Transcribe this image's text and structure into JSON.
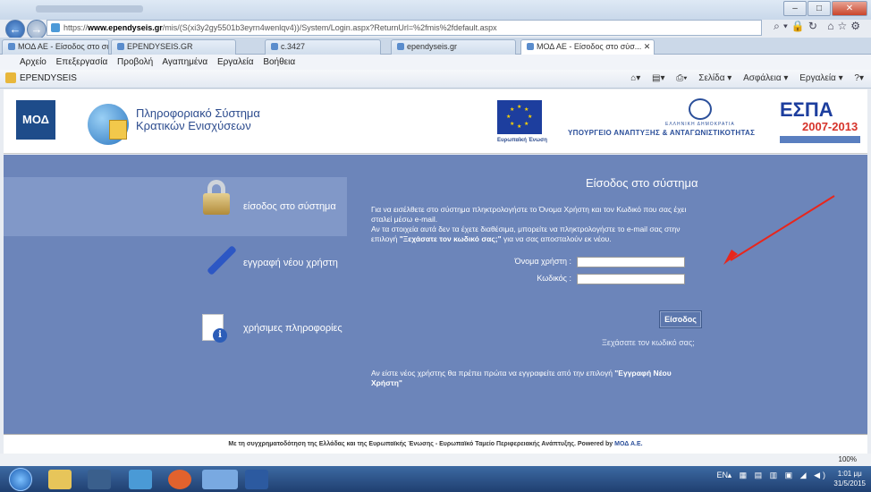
{
  "browser": {
    "url_prefix": "https://",
    "url_host": "www.ependyseis.gr",
    "url_path": "/mis/(S(xi3y2gy5501b3eyrn4wenlqv4))/System/Login.aspx?ReturnUrl=%2fmis%2fdefault.aspx",
    "tabs": [
      {
        "label": "ΜΟΔ ΑΕ - Είσοδος στο σύστημα"
      },
      {
        "label": "EPENDYSEIS.GR"
      },
      {
        "label": "c.3427"
      },
      {
        "label": "ependyseis.gr"
      },
      {
        "label": "ΜΟΔ ΑΕ - Είσοδος στο σύσ... ✕"
      }
    ],
    "menu": [
      "Αρχείο",
      "Επεξεργασία",
      "Προβολή",
      "Αγαπημένα",
      "Εργαλεία",
      "Βοήθεια"
    ],
    "favorite": "EPENDYSEIS",
    "commands": [
      "Σελίδα ▾",
      "Ασφάλεια ▾",
      "Εργαλεία ▾"
    ],
    "zoom": "100%"
  },
  "header": {
    "moa_logo": "ΜΟΔ",
    "system_title_line1": "Πληροφοριακό Σύστημα",
    "system_title_line2": "Κρατικών Ενισχύσεων",
    "eu_caption": "Ευρωπαϊκή Ένωση",
    "ministry_sub": "ΕΛΛΗΝΙΚΗ ΔΗΜΟΚΡΑΤΙΑ",
    "ministry": "ΥΠΟΥΡΓΕΙΟ ΑΝΑΠΤΥΞΗΣ & ΑΝΤΑΓΩΝΙΣΤΙΚΟΤΗΤΑΣ",
    "espa": "ΕΣΠΑ",
    "espa_years": "2007-2013"
  },
  "sidebar": {
    "items": [
      {
        "label": "είσοδος στο σύστημα",
        "icon": "padlock-icon"
      },
      {
        "label": "εγγραφή νέου χρήστη",
        "icon": "pen-icon"
      },
      {
        "label": "χρήσιμες πληροφορίες",
        "icon": "info-document-icon"
      }
    ]
  },
  "login": {
    "title": "Είσοδος στο σύστημα",
    "intro_line1": "Για να εισέλθετε στο σύστημα πληκτρολογήστε το Όνομα Χρήστη και τον Κωδικό που σας έχει σταλεί μέσω e-mail.",
    "intro_line2_a": "Αν τα στοιχεία αυτά δεν τα έχετε διαθέσιμα, μπορείτε να πληκτρολογήστε το e-mail σας στην επιλογή ",
    "intro_line2_b": "\"Ξεχάσατε τον κωδικό σας;\"",
    "intro_line2_c": " για να σας αποσταλούν εκ νέου.",
    "username_label": "Όνομα χρήστη :",
    "username_value": "",
    "password_label": "Κωδικός :",
    "password_value": "",
    "button": "Είσοδος",
    "forgot": "Ξεχάσατε τον κωδικό σας;",
    "newuser_a": "Αν είστε νέος χρήστης θα πρέπει πρώτα να εγγραφείτε από την επιλογή ",
    "newuser_b": "\"Εγγραφή Νέου Χρήστη\""
  },
  "footer": {
    "text": "Με τη συγχρηματοδότηση της Ελλάδας και της Ευρωπαϊκής Ένωσης - Ευρωπαϊκό Ταμείο Περιφερειακής Ανάπτυξης.",
    "powered": "Powered by",
    "company": "ΜΟΔ Α.Ε."
  },
  "taskbar": {
    "lang": "EN",
    "time": "1:01 μμ",
    "date": "31/5/2015"
  },
  "colors": {
    "main_bg": "#6c85ba",
    "active_item": "#8198c8",
    "arrow": "#e8261c"
  }
}
